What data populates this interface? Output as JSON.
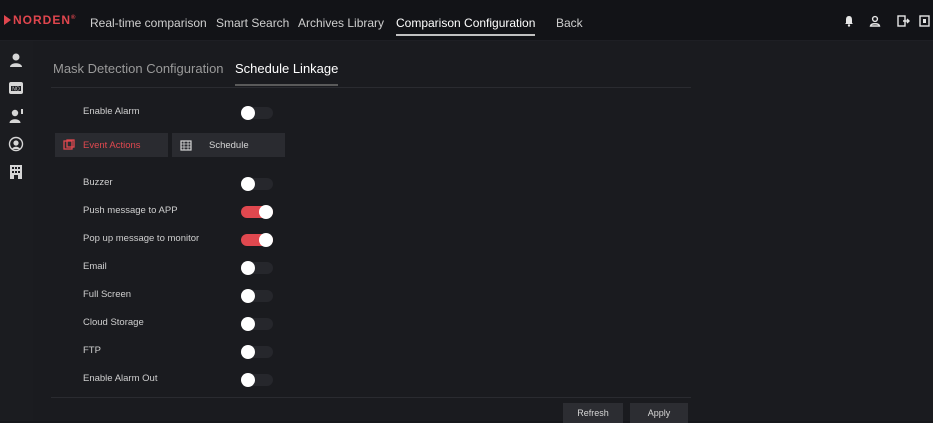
{
  "brand": {
    "name": "NORDEN",
    "mark": "®"
  },
  "nav": [
    {
      "label": "Real-time comparison"
    },
    {
      "label": "Smart Search"
    },
    {
      "label": "Archives Library"
    },
    {
      "label": "Comparison Configuration"
    },
    {
      "label": "Back"
    }
  ],
  "topbar_icons": [
    "bell-icon",
    "user-icon",
    "logout-icon",
    "fullscreen-icon"
  ],
  "sidebar_icons": [
    "person-icon",
    "no-mask-icon",
    "person-temp-icon",
    "face-scan-icon",
    "building-icon"
  ],
  "subtabs": {
    "mask": "Mask Detection Configuration",
    "schedule": "Schedule Linkage"
  },
  "enable_alarm": {
    "label": "Enable Alarm",
    "on": false
  },
  "action_tabs": {
    "event": "Event Actions",
    "schedule": "Schedule"
  },
  "actions": [
    {
      "label": "Buzzer",
      "on": false
    },
    {
      "label": "Push message to APP",
      "on": true
    },
    {
      "label": "Pop up message to monitor",
      "on": true
    },
    {
      "label": "Email",
      "on": false
    },
    {
      "label": "Full Screen",
      "on": false
    },
    {
      "label": "Cloud Storage",
      "on": false
    },
    {
      "label": "FTP",
      "on": false
    },
    {
      "label": "Enable Alarm Out",
      "on": false
    }
  ],
  "buttons": {
    "refresh": "Refresh",
    "apply": "Apply"
  },
  "colors": {
    "accent": "#e0484f",
    "background": "#16171b"
  }
}
